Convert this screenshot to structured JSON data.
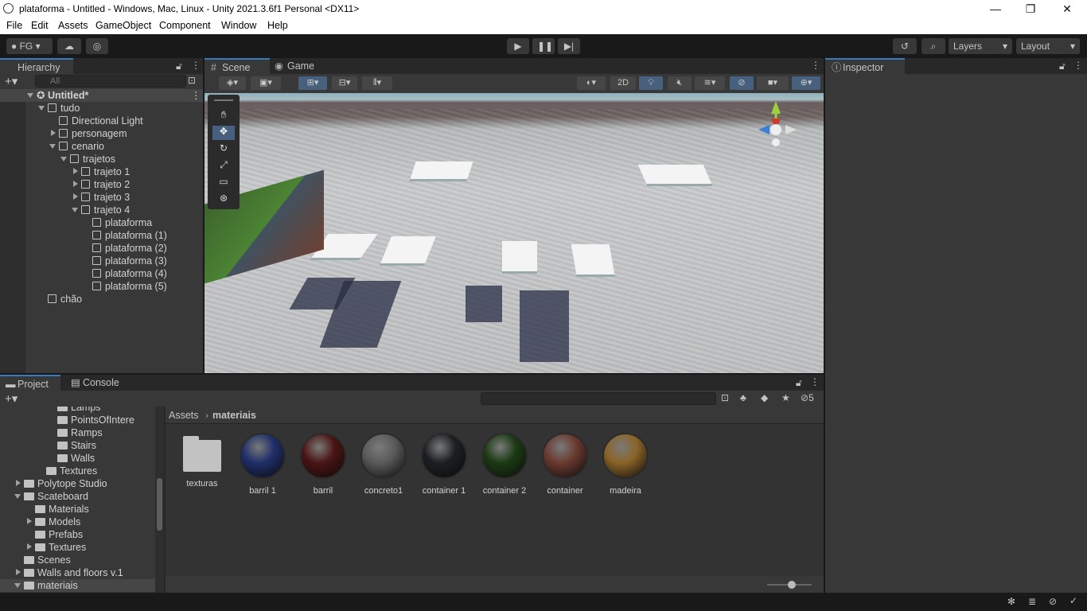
{
  "window": {
    "title": "plataforma - Untitled - Windows, Mac, Linux - Unity 2021.3.6f1 Personal <DX11>",
    "minimize": "—",
    "maximize": "❐",
    "close": "✕"
  },
  "menu": [
    "File",
    "Edit",
    "Assets",
    "GameObject",
    "Component",
    "Window",
    "Help"
  ],
  "toolbar": {
    "account": "FG",
    "layers": "Layers",
    "layout": "Layout"
  },
  "hierarchy": {
    "tab": "Hierarchy",
    "search_placeholder": "All",
    "scene": "Untitled*",
    "items": [
      {
        "label": "tudo",
        "depth": 1,
        "arrow": "down"
      },
      {
        "label": "Directional Light",
        "depth": 2,
        "arrow": "none"
      },
      {
        "label": "personagem",
        "depth": 2,
        "arrow": "right"
      },
      {
        "label": "cenario",
        "depth": 2,
        "arrow": "down"
      },
      {
        "label": "trajetos",
        "depth": 3,
        "arrow": "down"
      },
      {
        "label": "trajeto 1",
        "depth": 4,
        "arrow": "right"
      },
      {
        "label": "trajeto 2",
        "depth": 4,
        "arrow": "right"
      },
      {
        "label": "trajeto 3",
        "depth": 4,
        "arrow": "right"
      },
      {
        "label": "trajeto 4",
        "depth": 4,
        "arrow": "down"
      },
      {
        "label": "plataforma",
        "depth": 5,
        "arrow": "none"
      },
      {
        "label": "plataforma (1)",
        "depth": 5,
        "arrow": "none"
      },
      {
        "label": "plataforma (2)",
        "depth": 5,
        "arrow": "none"
      },
      {
        "label": "plataforma (3)",
        "depth": 5,
        "arrow": "none"
      },
      {
        "label": "plataforma (4)",
        "depth": 5,
        "arrow": "none"
      },
      {
        "label": "plataforma (5)",
        "depth": 5,
        "arrow": "none"
      },
      {
        "label": "chão",
        "depth": 1,
        "arrow": "none"
      }
    ]
  },
  "scene_view": {
    "tabs": [
      "Scene",
      "Game"
    ],
    "mode_2d": "2D"
  },
  "inspector": {
    "tab": "Inspector"
  },
  "project": {
    "tabs": [
      "Project",
      "Console"
    ],
    "hidden_count": "5",
    "breadcrumb": [
      "Assets",
      "materiais"
    ],
    "folders": [
      {
        "label": "Lamps",
        "depth": 3,
        "arrow": "none"
      },
      {
        "label": "PointsOfInterе",
        "depth": 3,
        "arrow": "none"
      },
      {
        "label": "Ramps",
        "depth": 3,
        "arrow": "none"
      },
      {
        "label": "Stairs",
        "depth": 3,
        "arrow": "none"
      },
      {
        "label": "Walls",
        "depth": 3,
        "arrow": "none"
      },
      {
        "label": "Textures",
        "depth": 2,
        "arrow": "none"
      },
      {
        "label": "Polytope Studio",
        "depth": 0,
        "arrow": "right"
      },
      {
        "label": "Scateboard",
        "depth": 0,
        "arrow": "down"
      },
      {
        "label": "Materials",
        "depth": 1,
        "arrow": "none"
      },
      {
        "label": "Models",
        "depth": 1,
        "arrow": "right"
      },
      {
        "label": "Prefabs",
        "depth": 1,
        "arrow": "none"
      },
      {
        "label": "Textures",
        "depth": 1,
        "arrow": "right"
      },
      {
        "label": "Scenes",
        "depth": 0,
        "arrow": "none"
      },
      {
        "label": "Walls and floors v.1",
        "depth": 0,
        "arrow": "right"
      },
      {
        "label": "materiais",
        "depth": 0,
        "arrow": "down"
      }
    ],
    "assets": [
      {
        "label": "texturas",
        "kind": "folder"
      },
      {
        "label": "barril 1",
        "color": "#1f2f6a"
      },
      {
        "label": "barril",
        "color": "#4a1414"
      },
      {
        "label": "concreto1",
        "color": "#5a5a5a"
      },
      {
        "label": "container 1",
        "color": "#1c1f22"
      },
      {
        "label": "container 2",
        "color": "#1c3a14"
      },
      {
        "label": "container",
        "color": "#6a3a30"
      },
      {
        "label": "madeira",
        "color": "#8a6428"
      }
    ]
  },
  "colors": {
    "accent": "#3a79bb",
    "panel": "#383838",
    "dark": "#282828"
  }
}
